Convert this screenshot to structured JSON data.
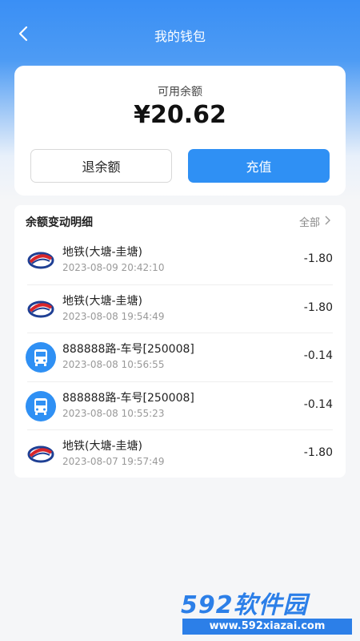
{
  "header": {
    "title": "我的钱包",
    "back_icon": "chevron-left-icon"
  },
  "balance": {
    "label": "可用余额",
    "amount": "¥20.62",
    "refund_label": "退余额",
    "recharge_label": "充值"
  },
  "details": {
    "title": "余额变动明细",
    "all_label": "全部",
    "items": [
      {
        "icon": "metro-logo-icon",
        "name": "地铁(大塘-圭塘)",
        "time": "2023-08-09 20:42:10",
        "amount": "-1.80"
      },
      {
        "icon": "metro-logo-icon",
        "name": "地铁(大塘-圭塘)",
        "time": "2023-08-08 19:54:49",
        "amount": "-1.80"
      },
      {
        "icon": "bus-icon",
        "name": "888888路-车号[250008]",
        "time": "2023-08-08 10:56:55",
        "amount": "-0.14"
      },
      {
        "icon": "bus-icon",
        "name": "888888路-车号[250008]",
        "time": "2023-08-08 10:55:23",
        "amount": "-0.14"
      },
      {
        "icon": "metro-logo-icon",
        "name": "地铁(大塘-圭塘)",
        "time": "2023-08-07 19:57:49",
        "amount": "-1.80"
      }
    ]
  },
  "watermark": {
    "brand": "592软件园",
    "url": "www.592xiazai.com"
  },
  "colors": {
    "accent": "#2f90f4",
    "metro_red": "#d7262b",
    "metro_blue": "#1e3f94"
  }
}
